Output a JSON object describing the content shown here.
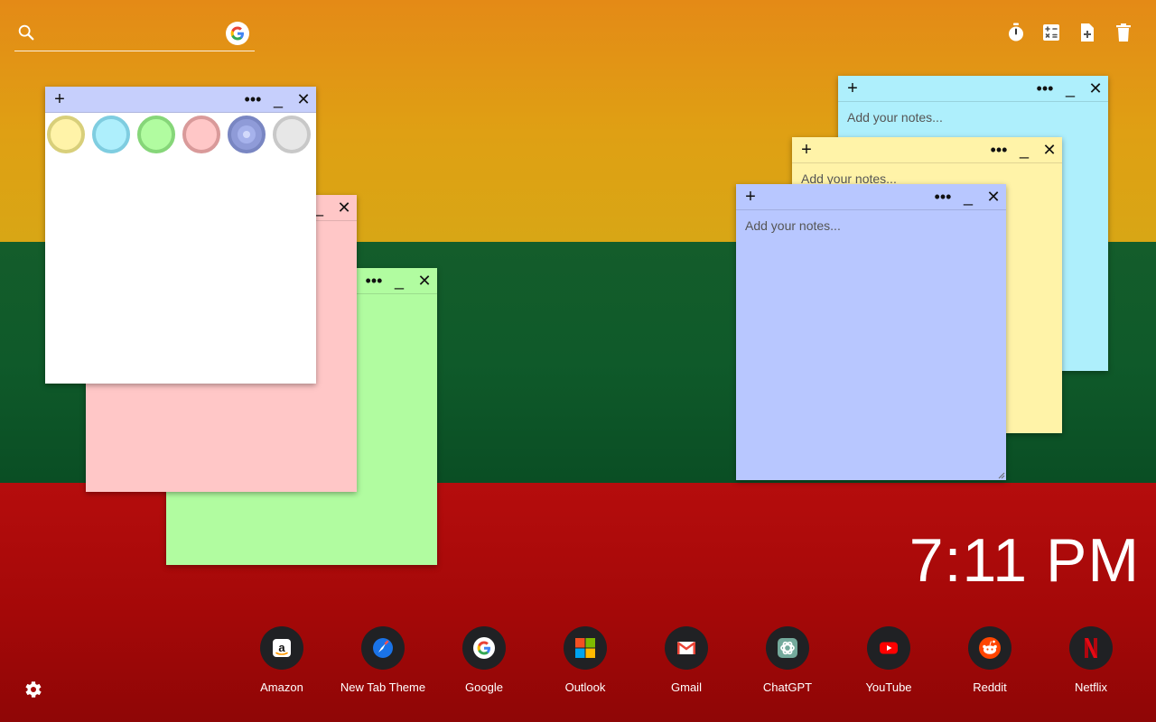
{
  "search": {
    "placeholder": "",
    "value": "",
    "icon": "search-icon",
    "engine_icon": "google-icon"
  },
  "toolbar": {
    "icons": [
      "timer-icon",
      "calculator-icon",
      "add-note-icon",
      "trash-icon"
    ]
  },
  "notes": {
    "placeholder": "Add your notes...",
    "plus": "+",
    "more": "•••",
    "minimize": "_",
    "close": "✕",
    "colors": {
      "white": "#ffffff",
      "pink": "#ffc7c7",
      "green": "#b1fca0",
      "cyan": "#aeeffc",
      "yellow": "#fff3a8",
      "blue": "#b8c7ff",
      "blue_header": "#c6cffc"
    },
    "swatches": [
      {
        "name": "yellow",
        "fill": "#fff3a8",
        "ring": "#d8cf7a"
      },
      {
        "name": "cyan",
        "fill": "#aeeffc",
        "ring": "#7fcde0"
      },
      {
        "name": "green",
        "fill": "#b1fca0",
        "ring": "#86d679"
      },
      {
        "name": "pink",
        "fill": "#ffc7c7",
        "ring": "#d99a9a"
      },
      {
        "name": "blue",
        "fill": "#8f9bd8",
        "ring": "#7986c2",
        "selected": true
      },
      {
        "name": "gray",
        "fill": "#e7e7e7",
        "ring": "#c8c8c8"
      }
    ]
  },
  "clock": {
    "time": "7:11 PM"
  },
  "shortcuts": [
    {
      "label": "Amazon",
      "icon": "amazon-icon"
    },
    {
      "label": "New Tab Theme",
      "icon": "new-tab-theme-icon"
    },
    {
      "label": "Google",
      "icon": "google-icon"
    },
    {
      "label": "Outlook",
      "icon": "outlook-icon"
    },
    {
      "label": "Gmail",
      "icon": "gmail-icon"
    },
    {
      "label": "ChatGPT",
      "icon": "chatgpt-icon"
    },
    {
      "label": "YouTube",
      "icon": "youtube-icon"
    },
    {
      "label": "Reddit",
      "icon": "reddit-icon"
    },
    {
      "label": "Netflix",
      "icon": "netflix-icon"
    }
  ],
  "settings": {
    "icon": "gear-icon"
  }
}
